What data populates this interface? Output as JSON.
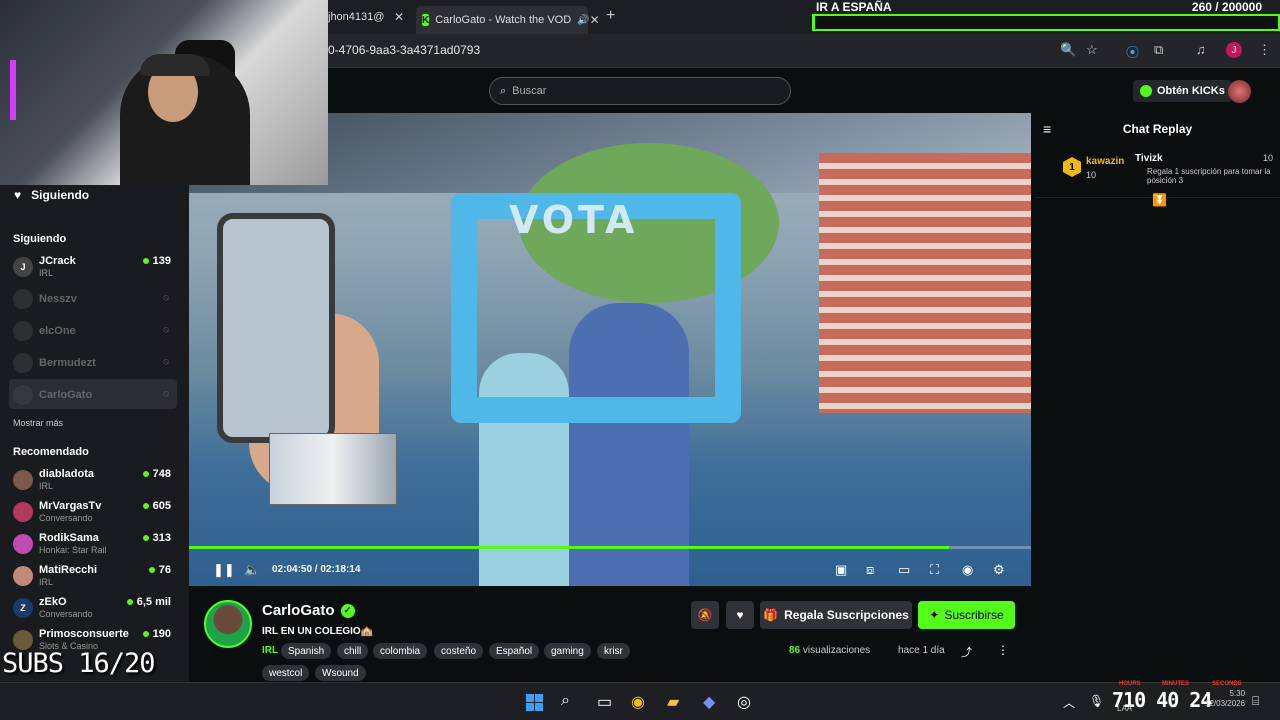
{
  "browser": {
    "tabs": [
      {
        "label": "jhon4131@"
      },
      {
        "label": "CarloGato - Watch the VOD"
      }
    ],
    "url": "0-4706-9aa3-3a4371ad0793",
    "profile_initial": "J"
  },
  "header": {
    "search_placeholder": "Buscar",
    "kicks_label": "Obtén KICKs"
  },
  "overlay": {
    "goal_title": "IR A ESPAÑA",
    "goal_count": "260 / 200000",
    "goal_progress": 0.0013,
    "subs_text": "SUBS 16/20"
  },
  "sidebar": {
    "following_header": "Siguiendo",
    "following_section": "Siguiendo",
    "following": [
      {
        "name": "JCrack",
        "category": "IRL",
        "viewers": "139",
        "live": true
      },
      {
        "name": "Nesszv",
        "live": false
      },
      {
        "name": "elcOne",
        "live": false
      },
      {
        "name": "Bermudezt",
        "live": false
      },
      {
        "name": "CarloGato",
        "live": false
      }
    ],
    "show_more": "Mostrar más",
    "recommended_section": "Recomendado",
    "recommended": [
      {
        "name": "diabladota",
        "category": "IRL",
        "viewers": "748"
      },
      {
        "name": "MrVargasTv",
        "category": "Conversando",
        "viewers": "605"
      },
      {
        "name": "RodikSama",
        "category": "Honkai: Star Rail",
        "viewers": "313"
      },
      {
        "name": "MatiRecchi",
        "category": "IRL",
        "viewers": "76"
      },
      {
        "name": "zEkO",
        "category": "Conversando",
        "viewers": "6,5 mil"
      },
      {
        "name": "Primosconsuerte",
        "category": "Slots & Casino",
        "viewers": "190"
      }
    ]
  },
  "video": {
    "vota_text": "VOTA",
    "current_time": "02:04:50",
    "duration": "02:18:14",
    "progress": 0.903
  },
  "chat": {
    "title": "Chat Replay",
    "gift": {
      "rank": "1",
      "user": "kawazin",
      "user_count": "10",
      "recipient": "Tivizk",
      "recipient_count": "10",
      "message": "Regala 1 suscripción para tomar la posición 3"
    }
  },
  "stream": {
    "channel": "CarloGato",
    "title": "IRL EN UN COLEGIO🏫",
    "category": "IRL",
    "tags_row1": [
      "Spanish",
      "chill",
      "colombia",
      "costeño",
      "Español",
      "gaming",
      "krisr"
    ],
    "tags_row2": [
      "westcol",
      "Wsound"
    ],
    "gift_subs_label": "Regala Suscripciones",
    "subscribe_label": "Suscribirse",
    "views_count": "86",
    "views_label": "visualizaciones",
    "ago": "hace 1 día"
  },
  "taskbar": {
    "clock_overlay": "710  40  24",
    "time": "5:30",
    "date": "12/03/2026",
    "lang": "LAA",
    "hours_label": "HOURS",
    "minutes_label": "MINUTES",
    "seconds_label": "SECONDS"
  },
  "colors": {
    "accent": "#53fc18",
    "background": "#0b0e0f",
    "sidebar": "#191b1f"
  }
}
